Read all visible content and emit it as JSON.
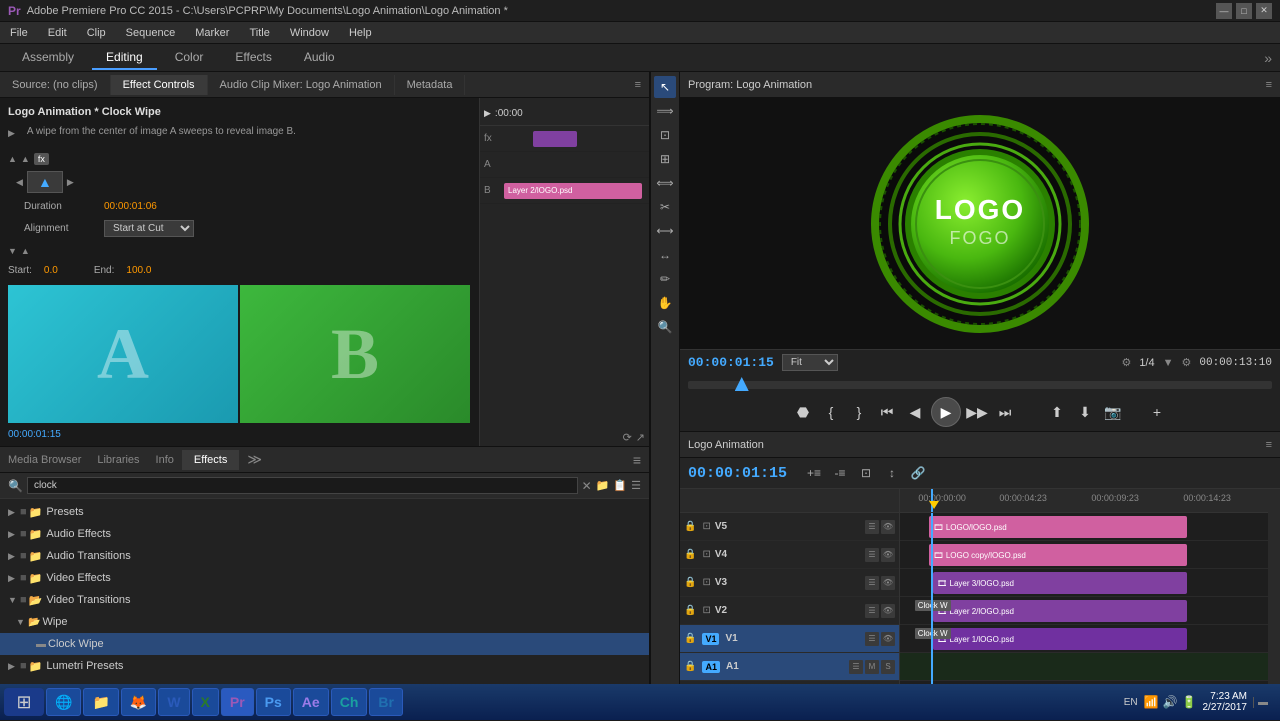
{
  "titlebar": {
    "title": "Adobe Premiere Pro CC 2015 - C:\\Users\\PCPRP\\My Documents\\Logo Animation\\Logo Animation *",
    "icon": "pr-icon"
  },
  "menubar": {
    "items": [
      "File",
      "Edit",
      "Clip",
      "Sequence",
      "Marker",
      "Title",
      "Window",
      "Help"
    ]
  },
  "workspace": {
    "tabs": [
      "Assembly",
      "Editing",
      "Color",
      "Effects",
      "Audio"
    ],
    "active": "Editing"
  },
  "source_panel": {
    "tab_label": "Source: (no clips)",
    "active_tab": "Effect Controls"
  },
  "effect_controls": {
    "tab_label": "Effect Controls",
    "audio_mixer_label": "Audio Clip Mixer: Logo Animation",
    "metadata_label": "Metadata",
    "title": "Logo Animation * Clock Wipe",
    "description": "A wipe from the center of image A sweeps to reveal image B.",
    "duration_label": "Duration",
    "duration_value": "00:00:01:06",
    "alignment_label": "Alignment",
    "alignment_value": "Start at Cut",
    "start_label": "Start:",
    "start_value": "0.0",
    "end_label": "End:",
    "end_value": "100.0",
    "timecode": "00:00:01:15",
    "thumb_a_letter": "A",
    "thumb_b_letter": "B",
    "mini_timecode": ":00:00"
  },
  "mini_timeline": {
    "labels": [
      "fx",
      "A",
      "B"
    ],
    "clip_label": "Layer 2/lOGO.psd"
  },
  "effects_panel": {
    "tab_label": "Effects",
    "search_placeholder": "clock",
    "search_value": "clock",
    "tree_items": [
      {
        "id": "presets",
        "label": "Presets",
        "level": 0,
        "type": "folder",
        "expanded": false
      },
      {
        "id": "audio-effects",
        "label": "Audio Effects",
        "level": 0,
        "type": "folder",
        "expanded": false
      },
      {
        "id": "audio-transitions",
        "label": "Audio Transitions",
        "level": 0,
        "type": "folder",
        "expanded": false
      },
      {
        "id": "video-effects",
        "label": "Video Effects",
        "level": 0,
        "type": "folder",
        "expanded": false
      },
      {
        "id": "video-transitions",
        "label": "Video Transitions",
        "level": 0,
        "type": "folder",
        "expanded": true
      },
      {
        "id": "wipe",
        "label": "Wipe",
        "level": 1,
        "type": "subfolder",
        "expanded": true
      },
      {
        "id": "clock-wipe",
        "label": "Clock Wipe",
        "level": 2,
        "type": "effect",
        "expanded": false,
        "selected": true
      },
      {
        "id": "lumetri",
        "label": "Lumetri Presets",
        "level": 0,
        "type": "folder",
        "expanded": false
      }
    ]
  },
  "program_monitor": {
    "tab_label": "Program: Logo Animation",
    "timecode": "00:00:01:15",
    "fit_label": "Fit",
    "fraction": "1/4",
    "duration": "00:00:13:10"
  },
  "timeline": {
    "tab_label": "Logo Animation",
    "timecode": "00:00:01:15",
    "tracks": [
      {
        "name": "V5",
        "type": "video"
      },
      {
        "name": "V4",
        "type": "video"
      },
      {
        "name": "V3",
        "type": "video"
      },
      {
        "name": "V2",
        "type": "video"
      },
      {
        "name": "V1",
        "type": "video",
        "active": true
      },
      {
        "name": "A1",
        "type": "audio",
        "active": true
      }
    ],
    "clips": [
      {
        "track": "V5",
        "label": "LOGO/lOGO.psd",
        "start": 0.3,
        "width": 0.7,
        "type": "pink"
      },
      {
        "track": "V4",
        "label": "LOGO copy/lOGO.psd",
        "start": 0.3,
        "width": 0.7,
        "type": "pink"
      },
      {
        "track": "V3",
        "label": "Layer 3/lOGO.psd",
        "start": 0.33,
        "width": 0.67,
        "type": "purple"
      },
      {
        "track": "V2",
        "label": "Layer 2/lOGO.psd",
        "start": 0.33,
        "width": 0.67,
        "type": "purple"
      },
      {
        "track": "V1",
        "label": "Layer 1/lOGO.psd",
        "start": 0.33,
        "width": 0.67,
        "type": "purple"
      }
    ],
    "ruler_times": [
      "00:00:00:00",
      "00:00:04:23",
      "00:00:09:23",
      "00:00:14:23"
    ],
    "playhead_pos": 0.085
  },
  "taskbar": {
    "start_icon": "⊞",
    "apps": [
      {
        "label": "Internet Explorer",
        "icon": "🌐"
      },
      {
        "label": "File Explorer",
        "icon": "📁"
      },
      {
        "label": "Firefox",
        "icon": "🦊"
      },
      {
        "label": "Word",
        "icon": "W"
      },
      {
        "label": "Excel",
        "icon": "X"
      },
      {
        "label": "Premiere Pro",
        "icon": "Pr",
        "active": true
      },
      {
        "label": "Photoshop",
        "icon": "Ps"
      },
      {
        "label": "After Effects",
        "icon": "Ae"
      },
      {
        "label": "Character Animator",
        "icon": "Ch"
      },
      {
        "label": "Bridge",
        "icon": "Br"
      }
    ],
    "language": "EN",
    "time": "7:23 AM",
    "date": "2/27/2017"
  }
}
